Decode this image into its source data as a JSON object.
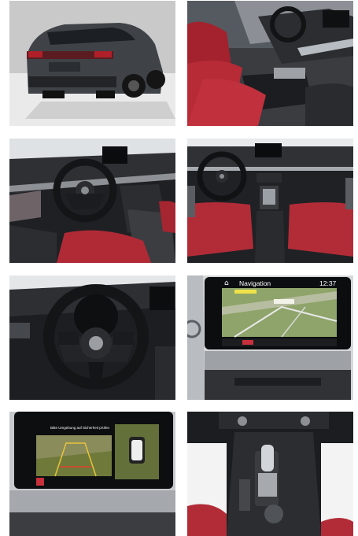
{
  "gallery": {
    "navigation_screen": {
      "title": "Navigation",
      "clock": "12:37"
    },
    "camera_screen": {
      "notice": "Bitte Umgebung auf Sicherheit prüfen"
    }
  }
}
